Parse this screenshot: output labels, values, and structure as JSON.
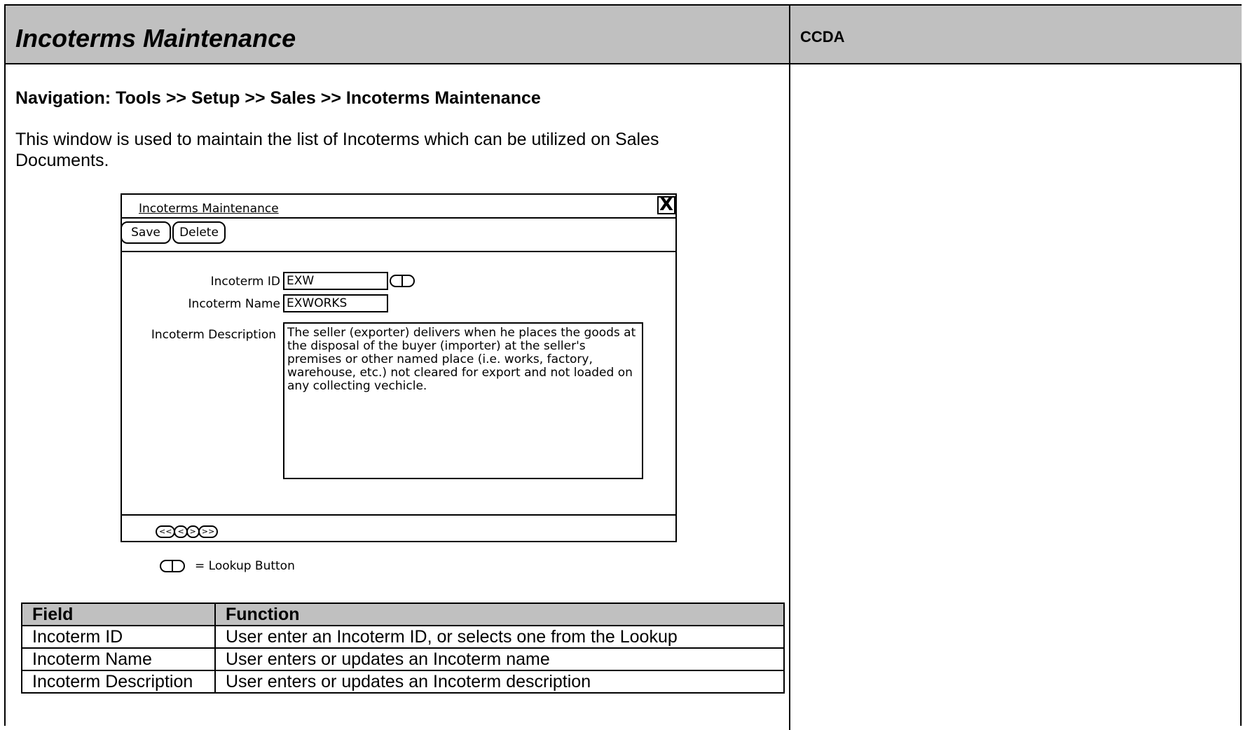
{
  "header": {
    "title": "Incoterms Maintenance",
    "right_label": "CCDA"
  },
  "navigation": "Navigation: Tools >> Setup >> Sales >> Incoterms Maintenance",
  "description": "This window is used to maintain the list of Incoterms which can be utilized on Sales Documents.",
  "mockup": {
    "window_title": "Incoterms Maintenance",
    "close_glyph": "X",
    "save_label": "Save",
    "delete_label": "Delete",
    "incoterm_id_label": "Incoterm ID",
    "incoterm_id_value": "EXW",
    "incoterm_name_label": "Incoterm Name",
    "incoterm_name_value": "EXWORKS",
    "incoterm_description_label": "Incoterm Description",
    "incoterm_description_value": "The seller (exporter) delivers when he places the goods at the disposal of the buyer (importer) at the seller's premises or other named place (i.e. works, factory, warehouse, etc.) not cleared for export and not loaded on any collecting vechicle.",
    "nav_first": "<<",
    "nav_prev": "<",
    "nav_next": ">",
    "nav_last": ">>"
  },
  "legend": {
    "text": "= Lookup Button"
  },
  "field_table": {
    "headers": [
      "Field",
      "Function"
    ],
    "rows": [
      [
        "Incoterm ID",
        "User enter an Incoterm ID, or selects one from the Lookup"
      ],
      [
        "Incoterm Name",
        "User enters or updates an Incoterm name"
      ],
      [
        "Incoterm Description",
        "User enters or updates an Incoterm description"
      ]
    ]
  }
}
